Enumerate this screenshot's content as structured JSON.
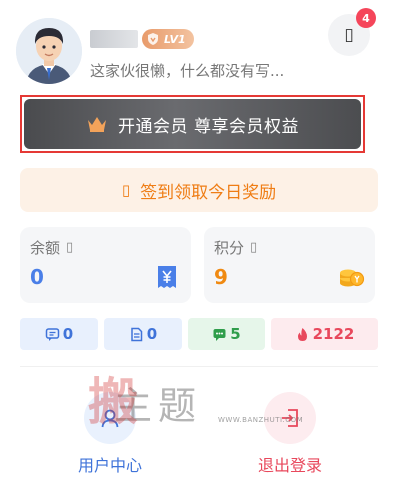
{
  "profile": {
    "username": "j",
    "level_badge": "LV1",
    "motto": "这家伙很懒，什么都没有写..."
  },
  "notifications": {
    "icon": "bell-icon",
    "count": "4"
  },
  "vip": {
    "label": "开通会员 尊享会员权益",
    "icon": "crown-icon"
  },
  "signin": {
    "icon": "gift-icon",
    "glyph": "▯",
    "label": "签到领取今日奖励"
  },
  "wallet": {
    "balance": {
      "label": "余额",
      "help_glyph": "▯",
      "value": "0",
      "icon": "yuan-ticket-icon"
    },
    "points": {
      "label": "积分",
      "help_glyph": "▯",
      "value": "9",
      "icon": "coins-icon"
    }
  },
  "stats": [
    {
      "icon": "comment-icon",
      "value": "0"
    },
    {
      "icon": "document-icon",
      "value": "0"
    },
    {
      "icon": "message-icon",
      "value": "5"
    },
    {
      "icon": "flame-icon",
      "value": "2122"
    }
  ],
  "watermark": {
    "seal_text": "搬",
    "text": "主题",
    "url": "WWW.BANZHUTI.COM"
  },
  "actions": {
    "user_center": {
      "label": "用户中心",
      "icon": "user-center-icon"
    },
    "logout": {
      "label": "退出登录",
      "icon": "logout-icon"
    }
  },
  "colors": {
    "accent_blue": "#3f73d9",
    "accent_orange": "#ef7d15",
    "accent_red": "#e8485c",
    "accent_green": "#2f9e4b",
    "badge_red": "#f5455a"
  }
}
